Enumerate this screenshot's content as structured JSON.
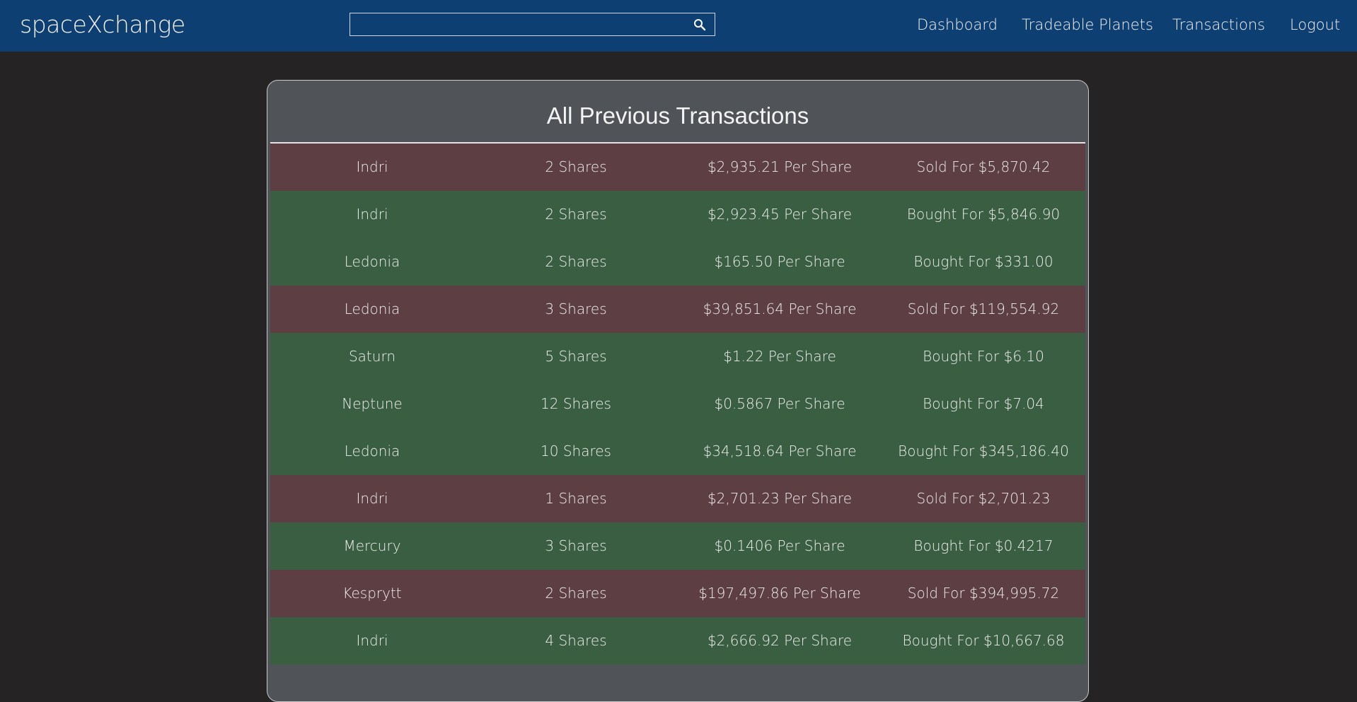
{
  "brand": "spaceXchange",
  "search": {
    "value": "",
    "placeholder": ""
  },
  "nav": {
    "dashboard": "Dashboard",
    "tradeable_planets": "Tradeable Planets",
    "transactions": "Transactions",
    "logout": "Logout"
  },
  "page": {
    "title": "All Previous Transactions"
  },
  "colors": {
    "navbar": "#0e3f72",
    "background": "#252324",
    "card": "#505357",
    "sold_row": "#5c3e43",
    "bought_row": "#3a5e42"
  },
  "transactions": [
    {
      "type": "sold",
      "planet": "Indri",
      "shares": "2 Shares",
      "price": "$2,935.21 Per Share",
      "total": "Sold For $5,870.42"
    },
    {
      "type": "bought",
      "planet": "Indri",
      "shares": "2 Shares",
      "price": "$2,923.45 Per Share",
      "total": "Bought For $5,846.90"
    },
    {
      "type": "bought",
      "planet": "Ledonia",
      "shares": "2 Shares",
      "price": "$165.50 Per Share",
      "total": "Bought For $331.00"
    },
    {
      "type": "sold",
      "planet": "Ledonia",
      "shares": "3 Shares",
      "price": "$39,851.64 Per Share",
      "total": "Sold For $119,554.92"
    },
    {
      "type": "bought",
      "planet": "Saturn",
      "shares": "5 Shares",
      "price": "$1.22 Per Share",
      "total": "Bought For $6.10"
    },
    {
      "type": "bought",
      "planet": "Neptune",
      "shares": "12 Shares",
      "price": "$0.5867 Per Share",
      "total": "Bought For $7.04"
    },
    {
      "type": "bought",
      "planet": "Ledonia",
      "shares": "10 Shares",
      "price": "$34,518.64 Per Share",
      "total": "Bought For $345,186.40"
    },
    {
      "type": "sold",
      "planet": "Indri",
      "shares": "1 Shares",
      "price": "$2,701.23 Per Share",
      "total": "Sold For $2,701.23"
    },
    {
      "type": "bought",
      "planet": "Mercury",
      "shares": "3 Shares",
      "price": "$0.1406 Per Share",
      "total": "Bought For $0.4217"
    },
    {
      "type": "sold",
      "planet": "Kesprytt",
      "shares": "2 Shares",
      "price": "$197,497.86 Per Share",
      "total": "Sold For $394,995.72"
    },
    {
      "type": "bought",
      "planet": "Indri",
      "shares": "4 Shares",
      "price": "$2,666.92 Per Share",
      "total": "Bought For $10,667.68"
    }
  ]
}
